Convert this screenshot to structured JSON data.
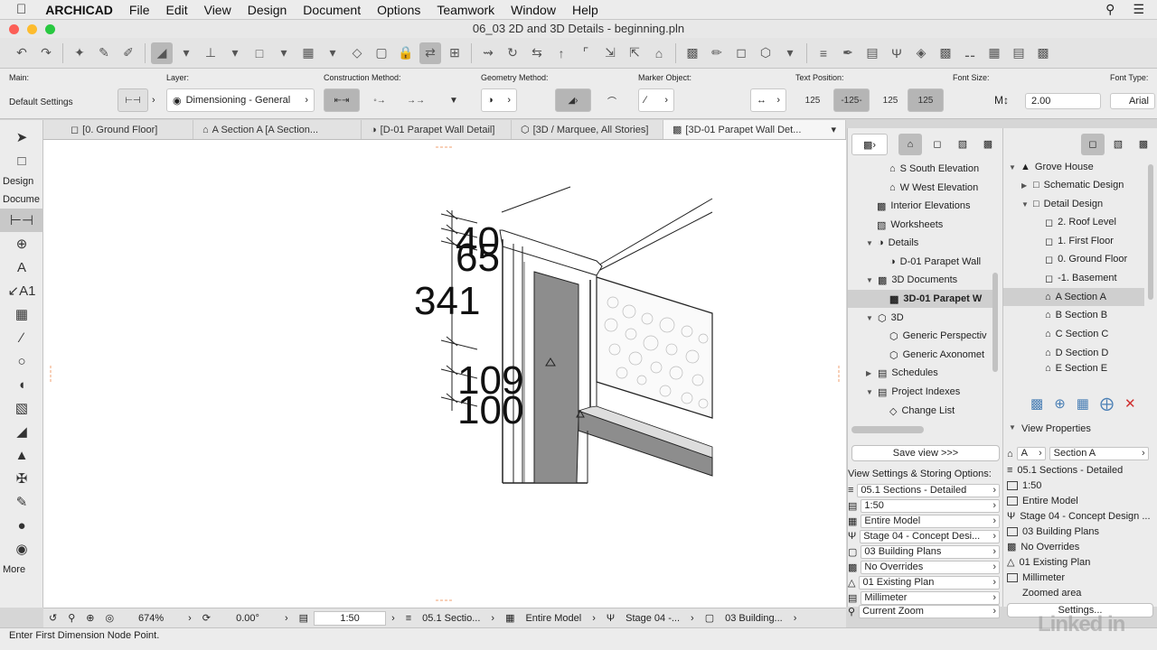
{
  "menubar": {
    "apple": "",
    "app": "ARCHICAD",
    "items": [
      "File",
      "Edit",
      "View",
      "Design",
      "Document",
      "Options",
      "Teamwork",
      "Window",
      "Help"
    ]
  },
  "window": {
    "title": "06_03 2D and 3D Details - beginning.pln"
  },
  "infobox": {
    "main_label": "Main:",
    "main_value": "Default Settings",
    "layer_label": "Layer:",
    "layer_value": "Dimensioning - General",
    "construction_label": "Construction Method:",
    "geometry_label": "Geometry Method:",
    "marker_label": "Marker Object:",
    "text_position_label": "Text Position:",
    "font_size_label": "Font Size:",
    "font_size_value": "2.00",
    "font_type_label": "Font Type:",
    "font_type_value": "Arial",
    "text_pos_options": [
      "125",
      "-125-",
      "125",
      "125"
    ]
  },
  "tabs": [
    {
      "label": "[0. Ground Floor]"
    },
    {
      "label": "A Section A [A Section..."
    },
    {
      "label": "[D-01 Parapet Wall Detail]"
    },
    {
      "label": "[3D / Marquee, All Stories]"
    },
    {
      "label": "[3D-01 Parapet Wall Det..."
    }
  ],
  "toolbox": {
    "design_header": "Design",
    "document_header": "Docume",
    "more": "More"
  },
  "drawing": {
    "dims": [
      "40",
      "65",
      "341",
      "109",
      "100"
    ]
  },
  "navigator": {
    "items": [
      {
        "label": "S South Elevation"
      },
      {
        "label": "W West Elevation"
      },
      {
        "label": "Interior Elevations"
      },
      {
        "label": "Worksheets"
      },
      {
        "label": "Details"
      },
      {
        "label": "D-01 Parapet Wall"
      },
      {
        "label": "3D Documents"
      },
      {
        "label": "3D-01 Parapet W"
      },
      {
        "label": "3D"
      },
      {
        "label": "Generic Perspectiv"
      },
      {
        "label": "Generic Axonomet"
      },
      {
        "label": "Schedules"
      },
      {
        "label": "Project Indexes"
      },
      {
        "label": "Change List"
      }
    ],
    "save_view": "Save view >>>",
    "view_settings_label": "View Settings & Storing Options:",
    "view_settings": [
      "05.1 Sections - Detailed",
      "1:50",
      "Entire Model",
      "Stage 04 - Concept Desi...",
      "03 Building Plans",
      "No Overrides",
      "01 Existing Plan",
      "Millimeter",
      "Current Zoom"
    ]
  },
  "project_tree": {
    "items": [
      {
        "label": "Grove House"
      },
      {
        "label": "Schematic Design"
      },
      {
        "label": "Detail Design"
      },
      {
        "label": "2. Roof Level"
      },
      {
        "label": "1. First Floor"
      },
      {
        "label": "0. Ground Floor"
      },
      {
        "label": "-1. Basement"
      },
      {
        "label": "A Section A"
      },
      {
        "label": "B Section B"
      },
      {
        "label": "C Section C"
      },
      {
        "label": "D Section D"
      },
      {
        "label": "E Section E"
      }
    ]
  },
  "view_properties": {
    "header": "View Properties",
    "id": "A",
    "name": "Section A",
    "rows": [
      "05.1 Sections - Detailed",
      "1:50",
      "Entire Model",
      "Stage 04 - Concept Design ...",
      "03 Building Plans",
      "No Overrides",
      "01 Existing Plan",
      "Millimeter",
      "Zoomed area"
    ],
    "settings_button": "Settings..."
  },
  "statusbar": {
    "zoom": "674%",
    "angle": "0.00°",
    "scale": "1:50",
    "layer_combo": "05.1 Sectio...",
    "model_view": "Entire Model",
    "renovation": "Stage 04 -...",
    "pen_set": "03 Building..."
  },
  "prompt": "Enter First Dimension Node Point.",
  "watermark": "Linked in"
}
